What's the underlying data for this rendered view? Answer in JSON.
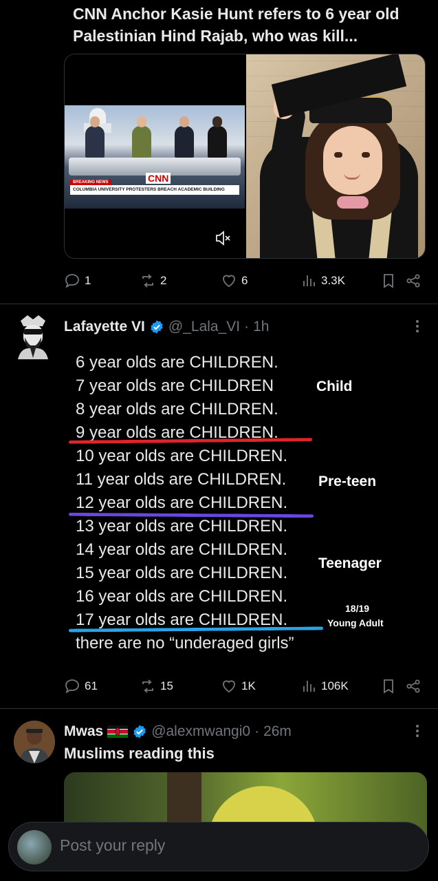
{
  "quoted": {
    "headline": "CNN Anchor Kasie Hunt refers to 6 year old Palestinian Hind Rajab, who was kill...",
    "video_breaking": "BREAKING NEWS",
    "video_chyron": "COLUMBIA UNIVERSITY PROTESTERS BREACH ACADEMIC BUILDING",
    "video_logo": "CNN",
    "stats": {
      "replies": "1",
      "reposts": "2",
      "likes": "6",
      "views": "3.3K"
    }
  },
  "main_tweet": {
    "display_name": "Lafayette VI",
    "handle": "@_Lala_VI",
    "time": "1h",
    "lines": [
      "6 year olds are CHILDREN.",
      "7 year olds are CHILDREN",
      "8 year olds are CHILDREN.",
      "9 year olds are CHILDREN.",
      "10 year olds are CHILDREN.",
      "11 year olds are CHILDREN.",
      "12 year olds are CHILDREN.",
      "13 year olds are CHILDREN.",
      "14 year olds are CHILDREN.",
      "15 year olds are CHILDREN.",
      "16 year olds are CHILDREN.",
      "17 year olds are CHILDREN.",
      "there are no “underaged girls”"
    ],
    "tags": {
      "child": "Child",
      "preteen": "Pre-teen",
      "teenager": "Teenager",
      "young_adult_age": "18/19",
      "young_adult": "Young Adult"
    },
    "underline_colors": {
      "red": "#e0242b",
      "purple": "#6a45e0",
      "blue": "#2aa3e6"
    },
    "stats": {
      "replies": "61",
      "reposts": "15",
      "likes": "1K",
      "views": "106K"
    }
  },
  "reply_tweet": {
    "display_name": "Mwas",
    "handle": "@alexmwangi0",
    "time": "26m",
    "text": "Muslims reading this"
  },
  "composer": {
    "placeholder": "Post your reply"
  },
  "colors": {
    "background": "#000000",
    "text": "#e7e9ea",
    "muted": "#71767b",
    "verified": "#1d9bf0"
  }
}
